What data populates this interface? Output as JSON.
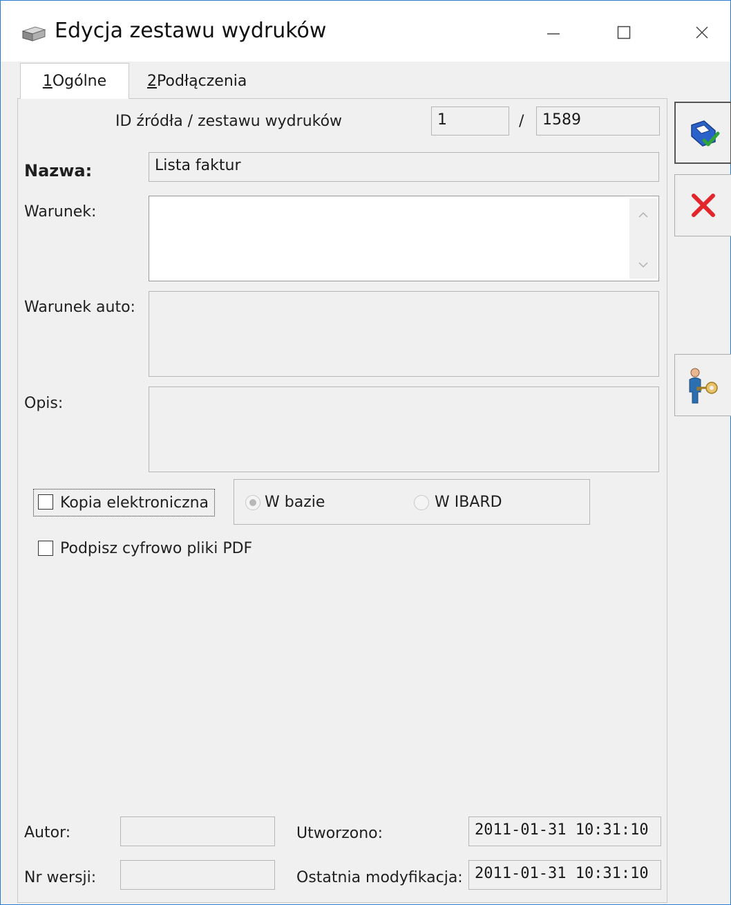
{
  "window": {
    "title": "Edycja zestawu wydruków"
  },
  "tabs": [
    {
      "hotkey": "1",
      "label": " Ogólne"
    },
    {
      "hotkey": "2",
      "label": " Podłączenia"
    }
  ],
  "form": {
    "id_label": "ID źródła / zestawu wydruków",
    "id_source": "1",
    "id_separator": "/",
    "id_set": "1589",
    "name_label": "Nazwa:",
    "name_value": "Lista faktur",
    "condition_label": "Warunek:",
    "condition_value": "",
    "auto_condition_label": "Warunek auto:",
    "auto_condition_value": "",
    "description_label": "Opis:",
    "description_value": "",
    "electronic_copy_label": "Kopia elektroniczna",
    "electronic_copy_checked": false,
    "storage_options": [
      {
        "label": "W bazie",
        "selected": true
      },
      {
        "label": "W IBARD",
        "selected": false
      }
    ],
    "sign_pdf_label": "Podpisz cyfrowo pliki PDF",
    "sign_pdf_checked": false,
    "author_label": "Autor:",
    "author_value": "",
    "version_label": "Nr wersji:",
    "version_value": "",
    "created_label": "Utworzono:",
    "created_value": "2011-01-31 10:31:10",
    "modified_label": "Ostatnia modyfikacja:",
    "modified_value": "2011-01-31 10:31:10"
  },
  "side_buttons": {
    "save_icon": "save-disk-check-icon",
    "cancel_icon": "red-x-icon",
    "permissions_icon": "user-key-icon"
  },
  "colors": {
    "window_border": "#2b7bd6",
    "save_blue": "#2a62c9",
    "check_green": "#2ea43a",
    "cancel_red": "#e3262b",
    "key_gold": "#d8a640"
  }
}
